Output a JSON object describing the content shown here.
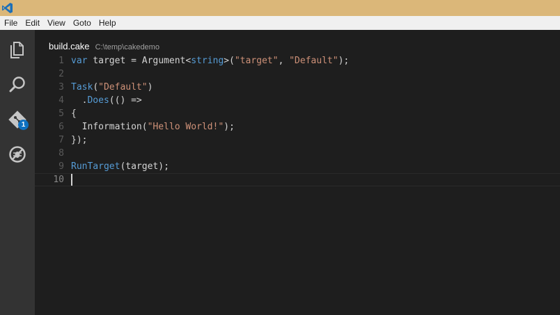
{
  "menubar": {
    "items": [
      "File",
      "Edit",
      "View",
      "Goto",
      "Help"
    ]
  },
  "activitybar": {
    "icons": [
      "files-icon",
      "search-icon",
      "git-icon",
      "debug-icon"
    ],
    "git_badge": "1",
    "badge_color": "#0e70c0"
  },
  "editor": {
    "file_name": "build.cake",
    "file_path": "C:\\temp\\cakedemo",
    "line_numbers": [
      "1",
      "2",
      "3",
      "4",
      "5",
      "6",
      "7",
      "8",
      "9",
      "10"
    ],
    "lines": [
      [
        {
          "t": "var",
          "c": "kw"
        },
        {
          "t": " target = Argument<"
        },
        {
          "t": "string",
          "c": "kw"
        },
        {
          "t": ">("
        },
        {
          "t": "\"target\"",
          "c": "str"
        },
        {
          "t": ", "
        },
        {
          "t": "\"Default\"",
          "c": "str"
        },
        {
          "t": ");"
        }
      ],
      [],
      [
        {
          "t": "Task",
          "c": "kw"
        },
        {
          "t": "("
        },
        {
          "t": "\"Default\"",
          "c": "str"
        },
        {
          "t": ")"
        }
      ],
      [
        {
          "t": "  ."
        },
        {
          "t": "Does",
          "c": "kw"
        },
        {
          "t": "(() =>"
        }
      ],
      [
        {
          "t": "{"
        }
      ],
      [
        {
          "t": "  Information("
        },
        {
          "t": "\"Hello World!\"",
          "c": "str"
        },
        {
          "t": ");"
        }
      ],
      [
        {
          "t": "});"
        }
      ],
      [],
      [
        {
          "t": "RunTarget",
          "c": "kw"
        },
        {
          "t": "(target);"
        }
      ],
      []
    ],
    "current_line": 10
  },
  "colors": {
    "titlebar": "#dbb779",
    "keyword": "#569cd6",
    "string": "#ce9178",
    "text": "#d4d4d4"
  }
}
